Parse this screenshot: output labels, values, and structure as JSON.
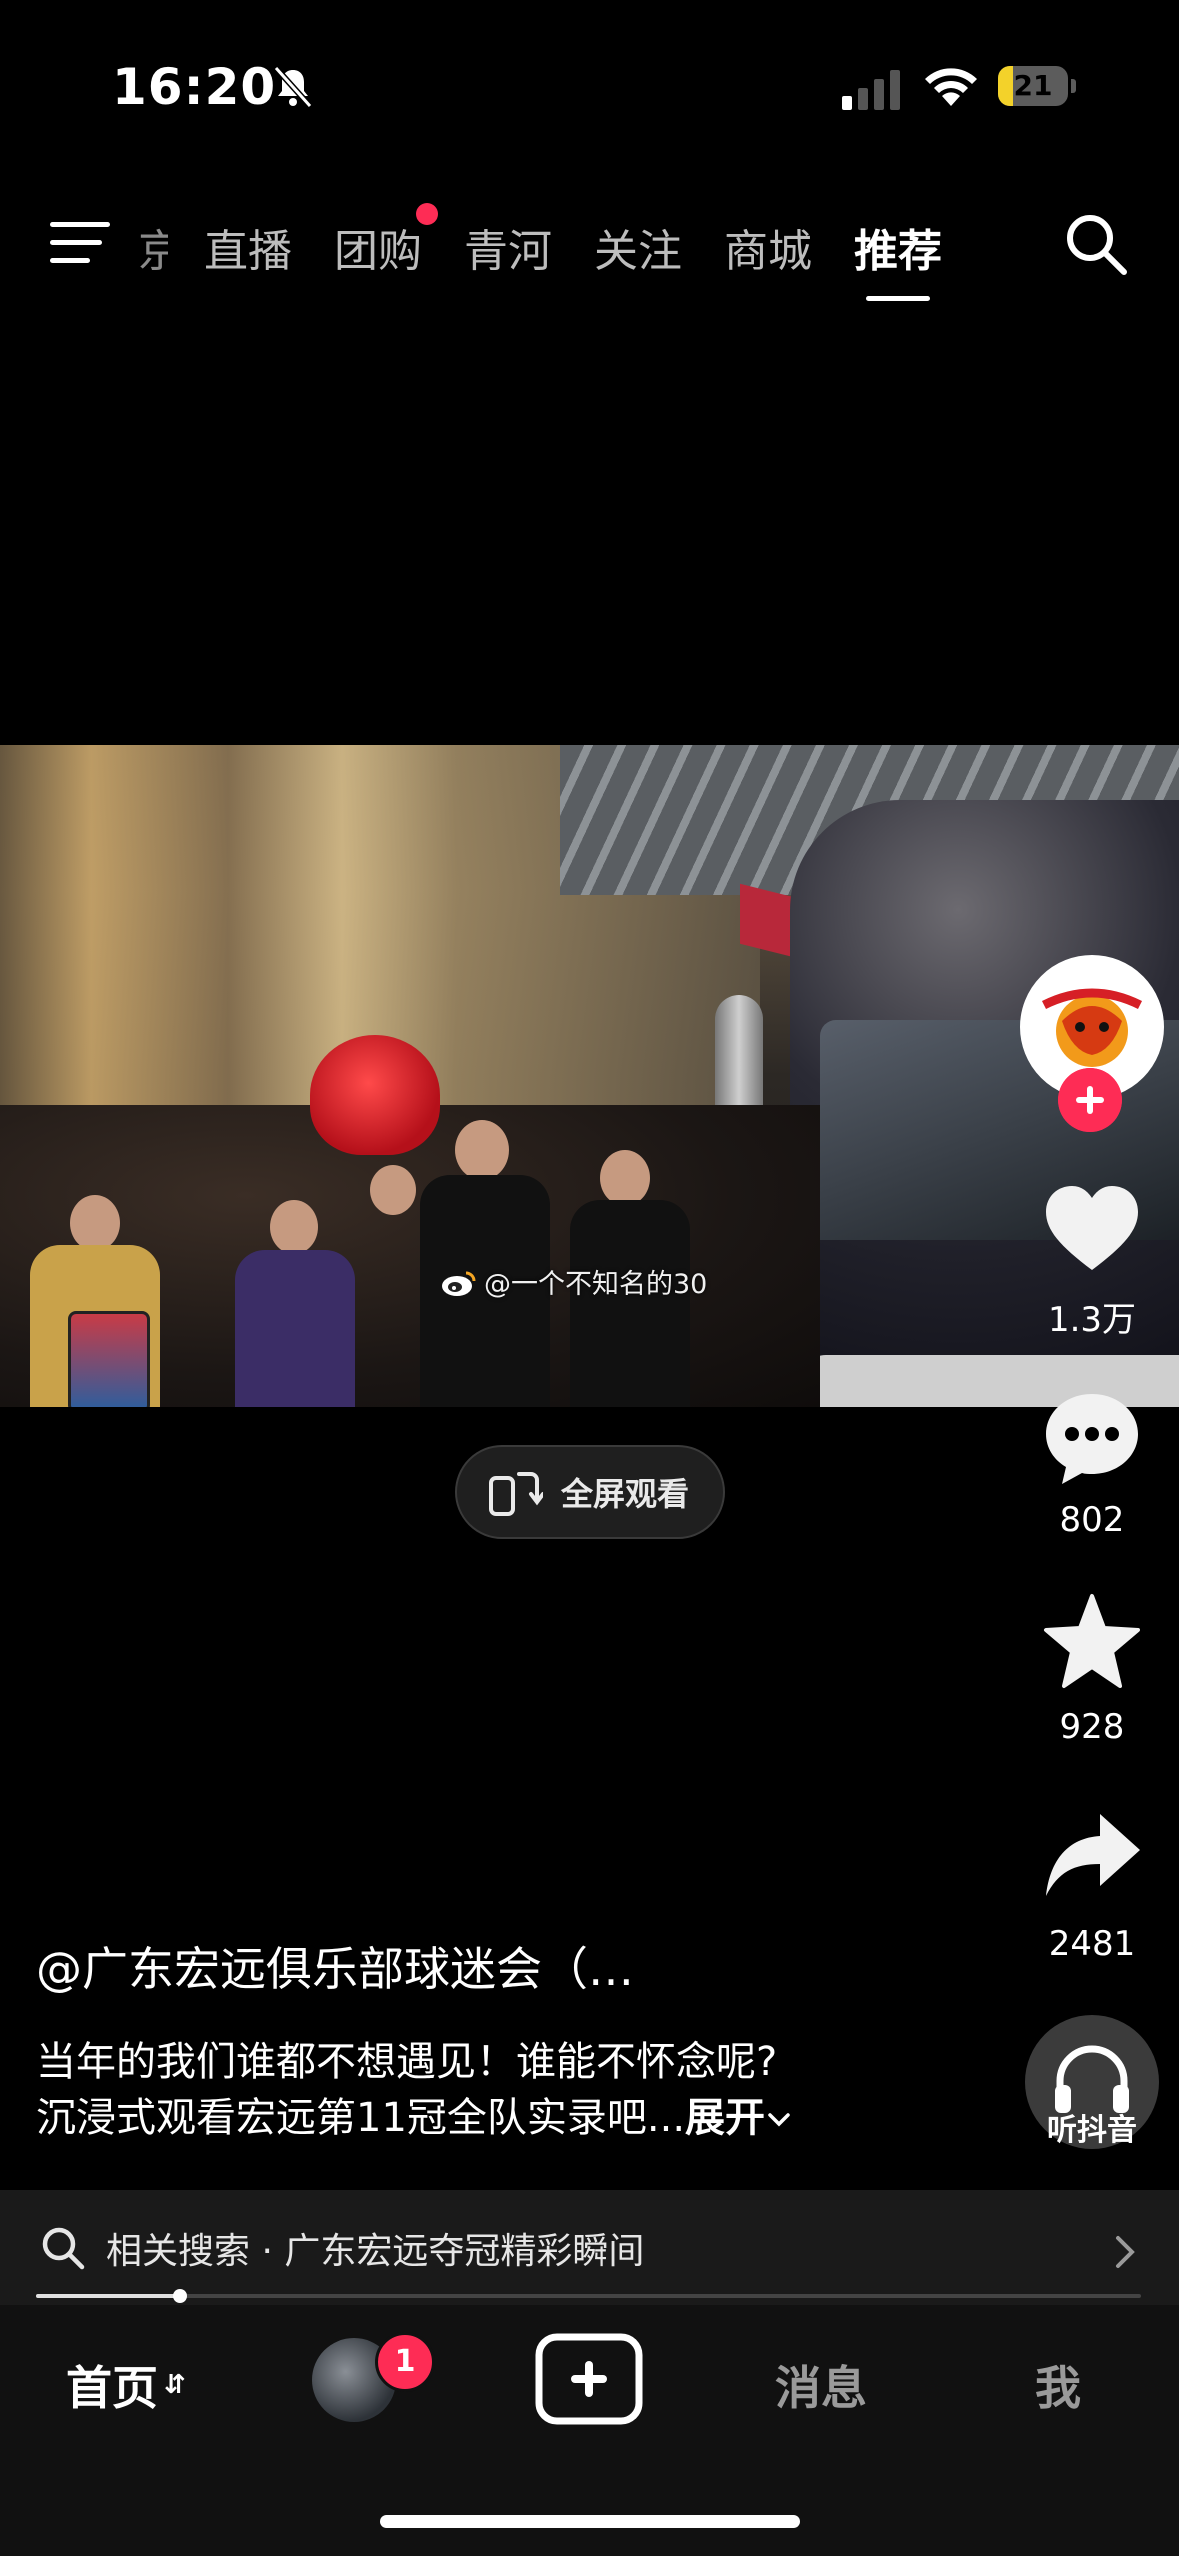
{
  "status_bar": {
    "time": "16:20",
    "battery_level": "21",
    "battery_fraction": 0.21
  },
  "top_nav": {
    "tabs": [
      {
        "label": "京"
      },
      {
        "label": "直播"
      },
      {
        "label": "团购",
        "has_dot": true
      },
      {
        "label": "青河"
      },
      {
        "label": "关注"
      },
      {
        "label": "商城"
      },
      {
        "label": "推荐",
        "active": true
      }
    ]
  },
  "video": {
    "watermark": "@一个不知名的30",
    "fullscreen_label": "全屏观看"
  },
  "right_rail": {
    "likes": "1.3万",
    "comments": "802",
    "favorites": "928",
    "shares": "2481",
    "listen_label": "听抖音"
  },
  "caption": {
    "author": "@广东宏远俱乐部球迷会（…",
    "line1": "当年的我们谁都不想遇见！谁能不怀念呢?",
    "line2": "沉浸式观看宏远第11冠全队实录吧...",
    "expand_label": "展开"
  },
  "related_search": {
    "prefix": "相关搜索",
    "query": "广东宏远夺冠精彩瞬间"
  },
  "playback": {
    "progress_fraction": 0.13
  },
  "bottom_nav": {
    "home": "首页",
    "friend_badge": "1",
    "messages": "消息",
    "me": "我"
  },
  "colors": {
    "accent": "#fe2c55",
    "background": "#000000",
    "battery": "#f3d22a"
  }
}
